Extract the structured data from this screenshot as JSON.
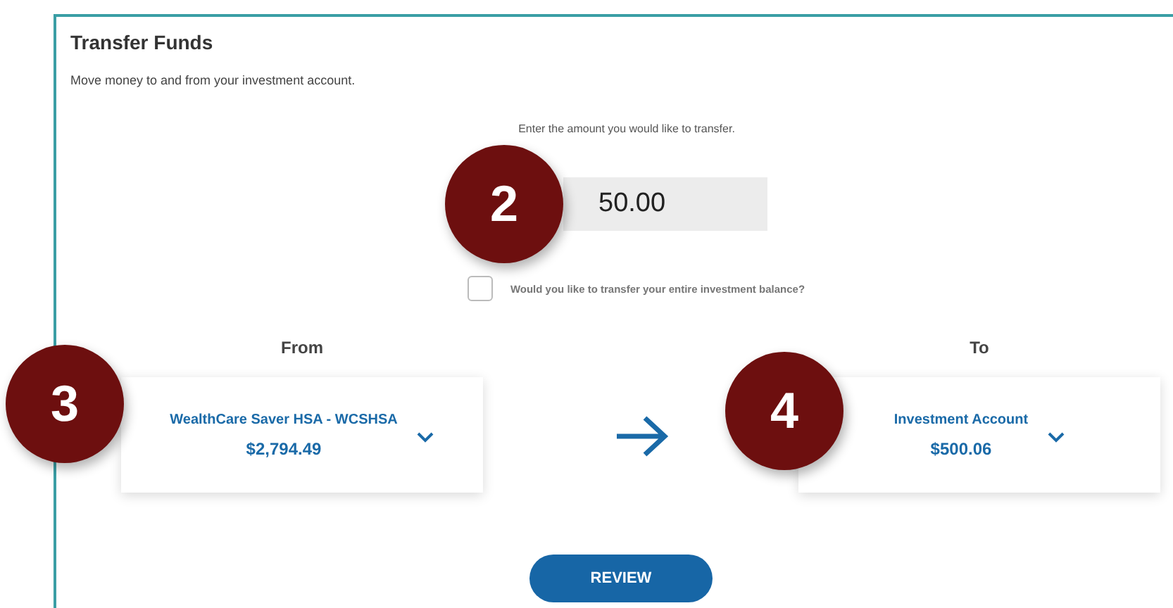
{
  "panel": {
    "title": "Transfer Funds",
    "subtitle": "Move money to and from your investment account."
  },
  "amount": {
    "prompt": "Enter the amount you would like to transfer.",
    "value": "50.00"
  },
  "entire_balance": {
    "label": "Would you like to transfer your entire investment balance?",
    "checked": false
  },
  "from": {
    "heading": "From",
    "account": "WealthCare Saver HSA - WCSHSA",
    "balance": "$2,794.49"
  },
  "to": {
    "heading": "To",
    "account": "Investment Account",
    "balance": "$500.06"
  },
  "review_button": "REVIEW",
  "callouts": [
    {
      "number": "2"
    },
    {
      "number": "3"
    },
    {
      "number": "4"
    }
  ]
}
